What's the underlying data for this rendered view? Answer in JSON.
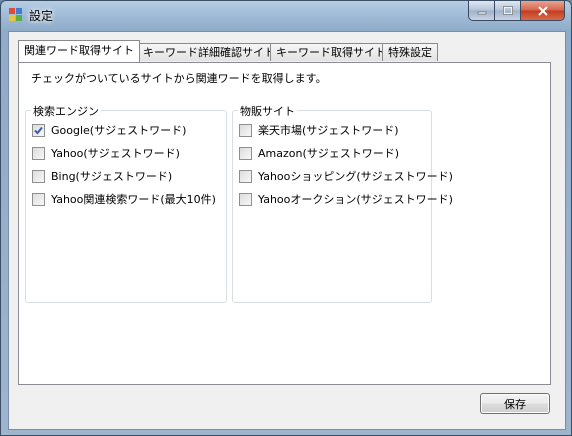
{
  "window": {
    "title": "設定",
    "icon_name": "app-icon",
    "caption_buttons": [
      "minimize-icon",
      "maximize-icon",
      "close-icon"
    ]
  },
  "tabs": [
    {
      "label": "関連ワード取得サイト",
      "active": true
    },
    {
      "label": "キーワード詳細確認サイト",
      "active": false
    },
    {
      "label": "キーワード取得サイト",
      "active": false
    },
    {
      "label": "特殊設定",
      "active": false
    }
  ],
  "panel": {
    "description": "チェックがついているサイトから関連ワードを取得します。",
    "search_engines": {
      "title": "検索エンジン",
      "items": [
        {
          "label": "Google(サジェストワード)",
          "checked": true
        },
        {
          "label": "Yahoo(サジェストワード)",
          "checked": false
        },
        {
          "label": "Bing(サジェストワード)",
          "checked": false
        },
        {
          "label": "Yahoo関連検索ワード(最大10件)",
          "checked": false
        }
      ]
    },
    "shopping_sites": {
      "title": "物販サイト",
      "items": [
        {
          "label": "楽天市場(サジェストワード)",
          "checked": false
        },
        {
          "label": "Amazon(サジェストワード)",
          "checked": false
        },
        {
          "label": "Yahooショッピング(サジェストワード)",
          "checked": false
        },
        {
          "label": "Yahooオークション(サジェストワード)",
          "checked": false
        }
      ]
    }
  },
  "buttons": {
    "save_label": "保存"
  },
  "colors": {
    "check_mark": "#3a5fa8",
    "close_button": "#c23c20"
  }
}
